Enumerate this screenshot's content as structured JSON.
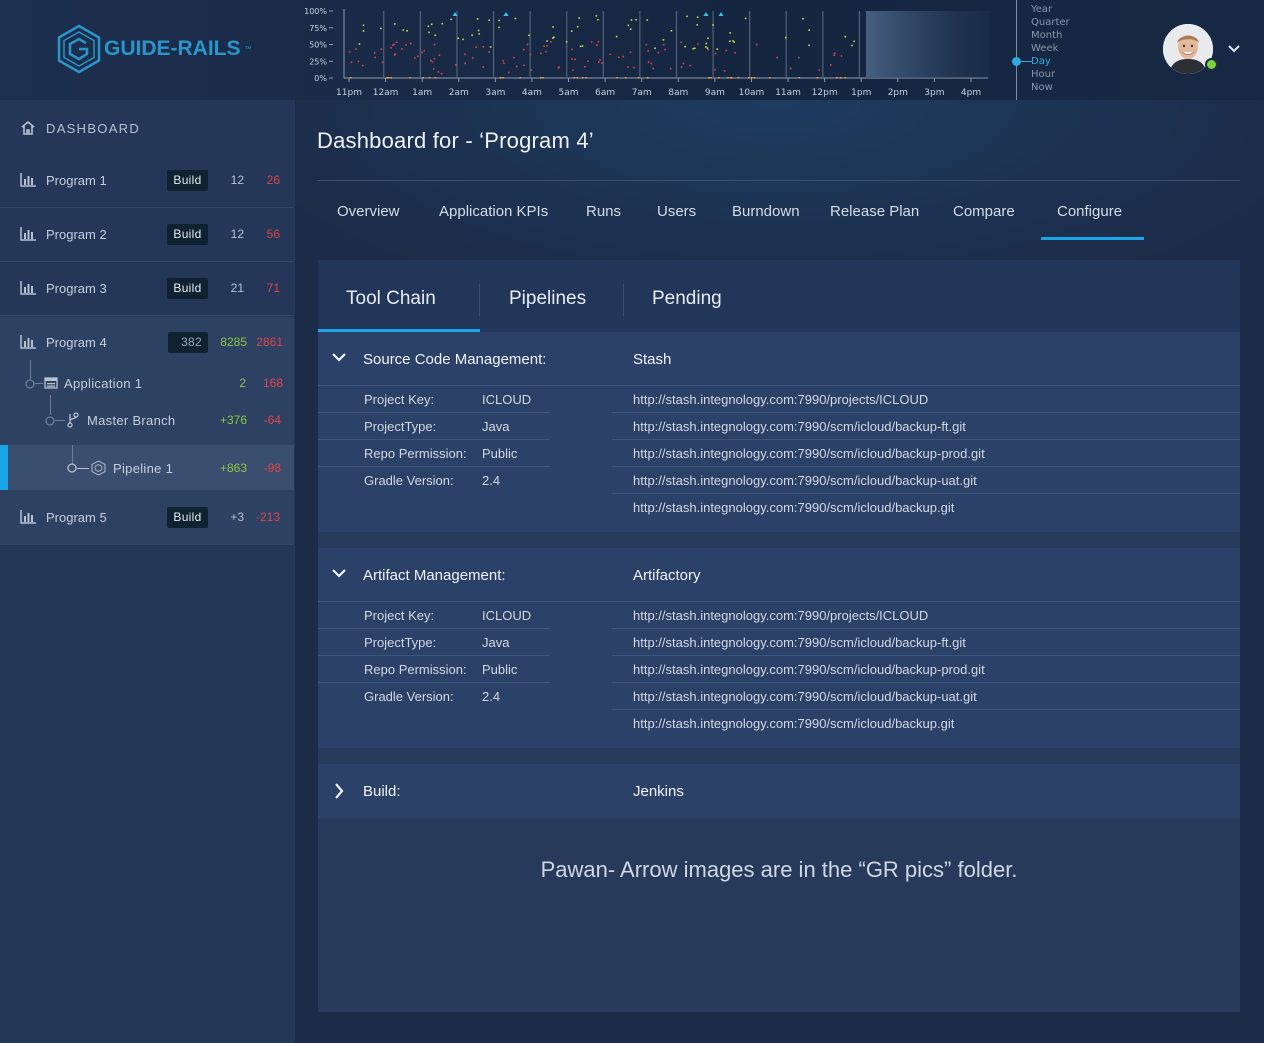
{
  "brand": {
    "logo_text": "GUIDE-RAILS",
    "logo_tm": "™",
    "accent": "#1aa6e6"
  },
  "timeline": {
    "y_ticks": [
      "100%",
      "75%",
      "50%",
      "25%",
      "0%"
    ],
    "x_ticks": [
      "11pm",
      "12am",
      "1am",
      "2am",
      "3am",
      "4am",
      "5am",
      "6am",
      "7am",
      "8am",
      "9am",
      "10am",
      "11am",
      "12pm",
      "1pm",
      "2pm",
      "3pm",
      "4pm"
    ],
    "ranges": [
      "Year",
      "Quarter",
      "Month",
      "Week",
      "Day",
      "Hour",
      "Now"
    ],
    "selected_range": "Day"
  },
  "user": {
    "status_color": "#7cd33a",
    "chevron_icon": "chevron-down-icon"
  },
  "sidebar": {
    "dashboard_label": "DASHBOARD",
    "programs": [
      {
        "name": "Program 1",
        "badge": "Build",
        "count": "12",
        "errors": "26"
      },
      {
        "name": "Program 2",
        "badge": "Build",
        "count": "12",
        "errors": "56"
      },
      {
        "name": "Program 3",
        "badge": "Build",
        "count": "21",
        "errors": "71"
      },
      {
        "name": "Program 4",
        "badge": "382",
        "count": "8285",
        "errors": "2861"
      },
      {
        "name": "Program 5",
        "badge": "Build",
        "count": "+3",
        "errors": "-213"
      }
    ],
    "application": {
      "name": "Application 1",
      "count": "2",
      "errors": "168"
    },
    "branch": {
      "name": "Master Branch",
      "count": "+376",
      "errors": "-64"
    },
    "pipeline": {
      "name": "Pipeline 1",
      "count": "+863",
      "errors": "-98"
    }
  },
  "main": {
    "title": "Dashboard for - ‘Program 4’",
    "tabs": [
      "Overview",
      "Application KPIs",
      "Runs",
      "Users",
      "Burndown",
      "Release Plan",
      "Compare",
      "Configure"
    ],
    "active_tab": "Configure",
    "subtabs": [
      "Tool Chain",
      "Pipelines",
      "Pending"
    ],
    "active_subtab": "Tool Chain",
    "sections": [
      {
        "title": "Source Code Management:",
        "tool": "Stash",
        "expanded": true,
        "props": [
          {
            "key": "Project Key:",
            "value": "ICLOUD"
          },
          {
            "key": "ProjectType:",
            "value": "Java"
          },
          {
            "key": "Repo Permission:",
            "value": "Public"
          },
          {
            "key": "Gradle Version:",
            "value": "2.4"
          }
        ],
        "urls": [
          "http://stash.integnology.com:7990/projects/ICLOUD",
          "http://stash.integnology.com:7990/scm/icloud/backup-ft.git",
          "http://stash.integnology.com:7990/scm/icloud/backup-prod.git",
          "http://stash.integnology.com:7990/scm/icloud/backup-uat.git",
          "http://stash.integnology.com:7990/scm/icloud/backup.git"
        ]
      },
      {
        "title": "Artifact Management:",
        "tool": "Artifactory",
        "expanded": true,
        "props": [
          {
            "key": "Project Key:",
            "value": "ICLOUD"
          },
          {
            "key": "ProjectType:",
            "value": "Java"
          },
          {
            "key": "Repo Permission:",
            "value": "Public"
          },
          {
            "key": "Gradle Version:",
            "value": "2.4"
          }
        ],
        "urls": [
          "http://stash.integnology.com:7990/projects/ICLOUD",
          "http://stash.integnology.com:7990/scm/icloud/backup-ft.git",
          "http://stash.integnology.com:7990/scm/icloud/backup-prod.git",
          "http://stash.integnology.com:7990/scm/icloud/backup-uat.git",
          "http://stash.integnology.com:7990/scm/icloud/backup.git"
        ]
      },
      {
        "title": "Build:",
        "tool": "Jenkins",
        "expanded": false
      }
    ],
    "note": "Pawan- Arrow images are in the “GR pics” folder."
  }
}
